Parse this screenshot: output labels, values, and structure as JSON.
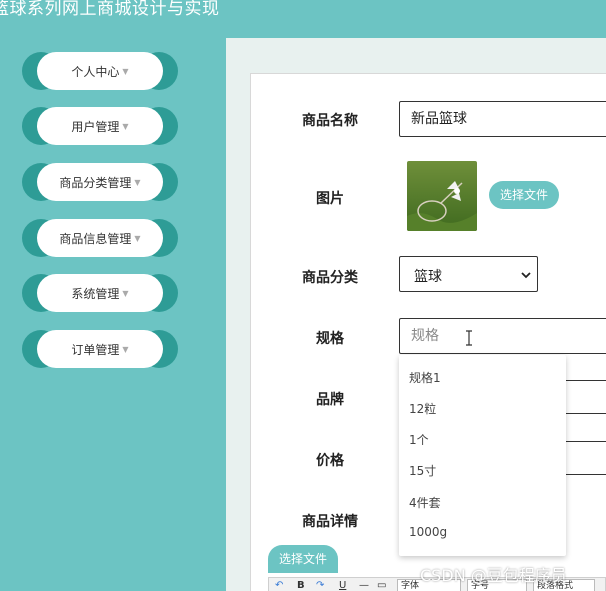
{
  "header": {
    "title": "篮球系列网上商城设计与实现"
  },
  "sidebar": {
    "items": [
      {
        "label": "个人中心"
      },
      {
        "label": "用户管理"
      },
      {
        "label": "商品分类管理"
      },
      {
        "label": "商品信息管理"
      },
      {
        "label": "系统管理"
      },
      {
        "label": "订单管理"
      }
    ],
    "caret": "▼"
  },
  "form": {
    "name_label": "商品名称",
    "name_value": "新品篮球",
    "image_label": "图片",
    "upload_label": "选择文件",
    "category_label": "商品分类",
    "category_value": "篮球",
    "spec_label": "规格",
    "spec_placeholder": "规格",
    "brand_label": "品牌",
    "price_label": "价格",
    "detail_label": "商品详情",
    "detail_upload_label": "选择文件"
  },
  "spec_suggestions": [
    "规格1",
    "12粒",
    "1个",
    "15寸",
    "4件套",
    "1000g"
  ],
  "editor_toolbar": {
    "font": "字体",
    "size": "字号",
    "paragraph": "段落格式"
  },
  "watermark": "CSDN @豆包程序员",
  "colors": {
    "accent": "#6cc4c3",
    "accent_dark": "#2e9c96",
    "content_bg": "#e8f1ef"
  }
}
